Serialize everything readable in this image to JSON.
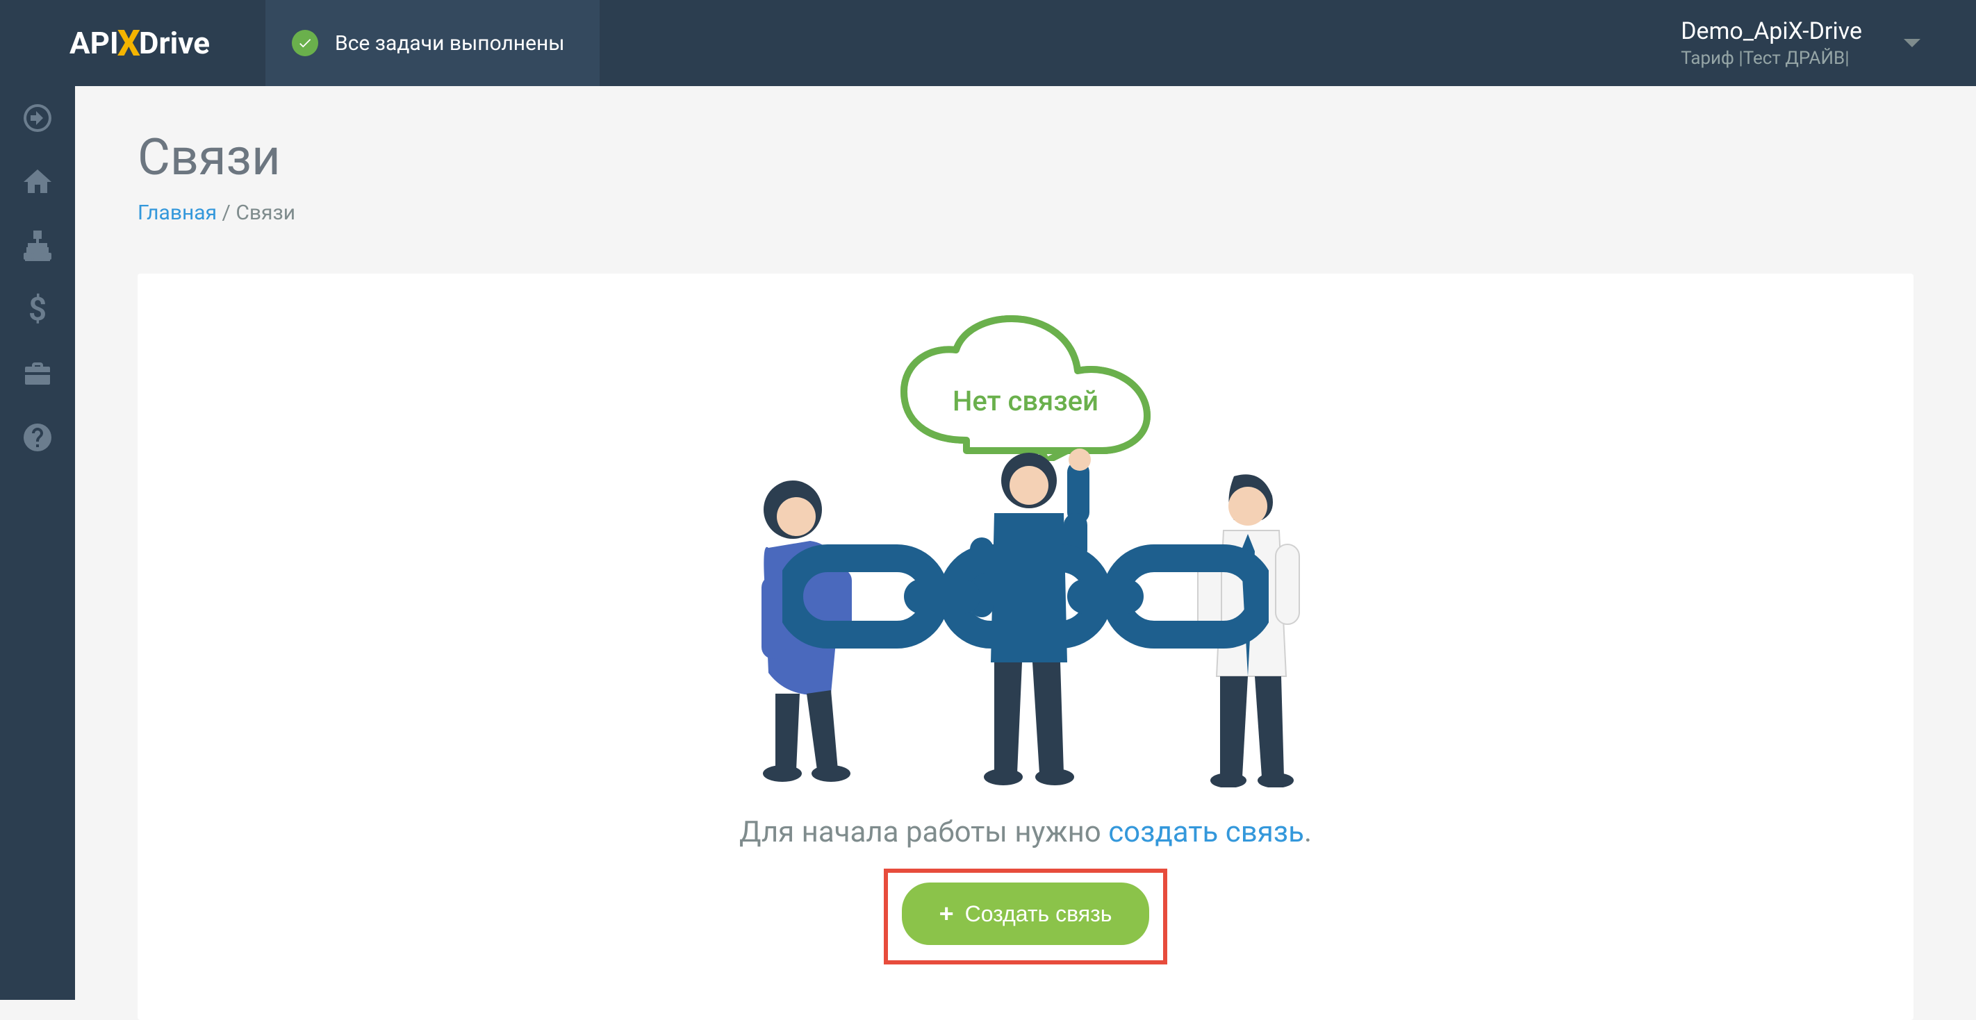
{
  "header": {
    "logo_api": "API",
    "logo_x": "X",
    "logo_drive": "Drive",
    "status_text": "Все задачи выполнены",
    "user_name": "Demo_ApiX-Drive",
    "user_tariff": "Тариф |Тест ДРАЙВ|"
  },
  "sidebar": {
    "items": [
      "arrow",
      "home",
      "sitemap",
      "dollar",
      "briefcase",
      "help"
    ]
  },
  "page": {
    "title": "Связи",
    "breadcrumb_home": "Главная",
    "breadcrumb_sep": " / ",
    "breadcrumb_current": "Связи"
  },
  "empty_state": {
    "cloud_text": "Нет связей",
    "instruction_prefix": "Для начала работы нужно ",
    "instruction_link": "создать связь",
    "instruction_suffix": ".",
    "button_plus": "+",
    "button_label": "Создать связь"
  }
}
